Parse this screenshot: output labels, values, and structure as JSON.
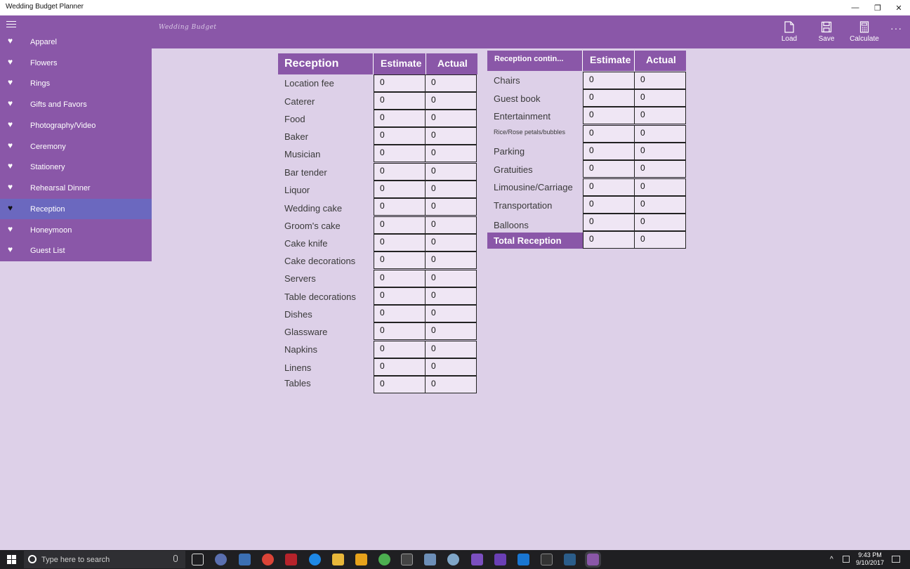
{
  "window": {
    "title": "Wedding Budget Planner",
    "minimize": "—",
    "restore": "❐",
    "close": "✕"
  },
  "header": {
    "subtitle": "Wedding Budget",
    "commands": {
      "load": "Load",
      "save": "Save",
      "calculate": "Calculate"
    },
    "more": "···"
  },
  "sidebar": {
    "items": [
      {
        "label": "Apparel"
      },
      {
        "label": "Flowers"
      },
      {
        "label": "Rings"
      },
      {
        "label": "Gifts and Favors"
      },
      {
        "label": "Photography/Video"
      },
      {
        "label": "Ceremony"
      },
      {
        "label": "Stationery"
      },
      {
        "label": "Rehearsal Dinner"
      },
      {
        "label": "Reception",
        "selected": true
      },
      {
        "label": "Honeymoon"
      },
      {
        "label": "Guest List"
      }
    ]
  },
  "table1": {
    "title": "Reception",
    "estimate_header": "Estimate",
    "actual_header": "Actual",
    "rows": [
      {
        "label": "Location fee",
        "estimate": "0",
        "actual": "0"
      },
      {
        "label": "Caterer",
        "estimate": "0",
        "actual": "0"
      },
      {
        "label": "Food",
        "estimate": "0",
        "actual": "0"
      },
      {
        "label": "Baker",
        "estimate": "0",
        "actual": "0"
      },
      {
        "label": "Musician",
        "estimate": "0",
        "actual": "0"
      },
      {
        "label": "Bar tender",
        "estimate": "0",
        "actual": "0"
      },
      {
        "label": "Liquor",
        "estimate": "0",
        "actual": "0"
      },
      {
        "label": "Wedding cake",
        "estimate": "0",
        "actual": "0"
      },
      {
        "label": "Groom's cake",
        "estimate": "0",
        "actual": "0"
      },
      {
        "label": "Cake knife",
        "estimate": "0",
        "actual": "0"
      },
      {
        "label": "Cake decorations",
        "estimate": "0",
        "actual": "0"
      },
      {
        "label": "Servers",
        "estimate": "0",
        "actual": "0"
      },
      {
        "label": "Table decorations",
        "estimate": "0",
        "actual": "0"
      },
      {
        "label": "Dishes",
        "estimate": "0",
        "actual": "0"
      },
      {
        "label": "Glassware",
        "estimate": "0",
        "actual": "0"
      },
      {
        "label": "Napkins",
        "estimate": "0",
        "actual": "0"
      },
      {
        "label": "Linens",
        "estimate": "0",
        "actual": "0"
      },
      {
        "label": "Tables",
        "estimate": "0",
        "actual": "0"
      }
    ]
  },
  "table2": {
    "title": "Reception contin...",
    "estimate_header": "Estimate",
    "actual_header": "Actual",
    "rows": [
      {
        "label": "Chairs",
        "estimate": "0",
        "actual": "0"
      },
      {
        "label": "Guest book",
        "estimate": "0",
        "actual": "0"
      },
      {
        "label": "Entertainment",
        "estimate": "0",
        "actual": "0"
      },
      {
        "label": "Rice/Rose petals/bubbles",
        "estimate": "0",
        "actual": "0"
      },
      {
        "label": "Parking",
        "estimate": "0",
        "actual": "0"
      },
      {
        "label": "Gratuities",
        "estimate": "0",
        "actual": "0"
      },
      {
        "label": "Limousine/Carriage",
        "estimate": "0",
        "actual": "0"
      },
      {
        "label": "Transportation",
        "estimate": "0",
        "actual": "0"
      },
      {
        "label": "Balloons",
        "estimate": "0",
        "actual": "0"
      }
    ],
    "total": {
      "label": "Total Reception",
      "estimate": "0",
      "actual": "0"
    }
  },
  "taskbar": {
    "search_placeholder": "Type here to search",
    "time": "9:43 PM",
    "date": "9/10/2017",
    "tray_chevron": "^"
  },
  "colors": {
    "accent": "#8a57a8",
    "selected": "#6b68bf",
    "background": "#ddd0e8"
  }
}
